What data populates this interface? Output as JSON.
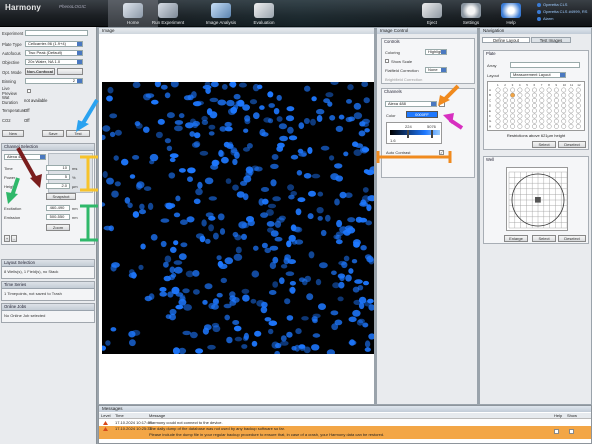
{
  "app": {
    "name": "Harmony",
    "edition": "PhenoLOGIC"
  },
  "nav_tabs": [
    {
      "label": "Home"
    },
    {
      "label": "Run Experiment"
    },
    {
      "label": "Image Analysis"
    },
    {
      "label": "Evaluation"
    },
    {
      "label": "Eject"
    },
    {
      "label": "Settings"
    },
    {
      "label": "Help"
    },
    {
      "label": "Logout"
    }
  ],
  "status": [
    "Operetta CLS",
    "Operetta CLS #4999, RS",
    "Alarm"
  ],
  "setup": {
    "experiment_label": "Experiment",
    "plate_type_label": "Plate Type",
    "plate_type": "Cellcarrier-96 (1.9+4)",
    "autofocus_label": "Autofocus",
    "autofocus": "Two Peak (Default)",
    "objective_label": "Objective",
    "objective": "20x Water, NA 1.0",
    "opt_mode_label": "Opt. Mode",
    "opt_mode": "Non-Confocal",
    "binning_label": "Binning",
    "binning": "2",
    "live_preview_label": "Live Preview",
    "water_dur_label": "Wat Duration",
    "water_dur": "not available",
    "temperature_label": "Temperature",
    "temperature": "Off",
    "co2_label": "CO2",
    "co2": "Off",
    "btn_new": "New",
    "btn_save": "Save",
    "btn_test": "Test"
  },
  "channel": {
    "title": "Channel Selection",
    "name": "Alexa 488",
    "time_label": "Time",
    "time": "10",
    "time_unit": "ms",
    "power_label": "Power",
    "power": "5",
    "power_unit": "%",
    "height_label": "Height",
    "height": "2.0",
    "height_unit": "µm",
    "snapshot": "Snapshot",
    "excitation_label": "Excitation",
    "excitation": "460-490",
    "excitation_unit": "nm",
    "emission_label": "Emission",
    "emission": "500-550",
    "emission_unit": "nm",
    "zoom": "Zoom"
  },
  "layout_selection": {
    "title": "Layout Selection",
    "text": "8 Wells(s), 1 Field(s), no Stack"
  },
  "time_series": {
    "title": "Time Series",
    "text": "1 Timepoints, not saved to Trash"
  },
  "online_jobs": {
    "title": "Online Jobs",
    "text": "No Online Job selected"
  },
  "image": {
    "tab": "Image"
  },
  "image_control": {
    "title": "Image Control",
    "controls_title": "Controls",
    "coloring_label": "Coloring",
    "coloring": "Highlight",
    "show_scale_label": "Show Scale",
    "flatfield_label": "Flatfield Correction",
    "flatfield": "None",
    "brightfield_label": "Brightfield Correction",
    "channels_title": "Channels",
    "channel_name": "Alexa 488",
    "color_label": "Color",
    "color_value": "0000FF",
    "range_lo": "224",
    "range_hi": "5076",
    "range_axis_lo": "1.6",
    "auto_contrast_label": "Auto Contrast"
  },
  "navigation": {
    "title": "Navigation",
    "tab_define": "Define Layout",
    "tab_test": "Test Images",
    "plate_title": "Plate",
    "array_label": "Array",
    "layout_label": "Layout",
    "layout": "Measurement Layout",
    "rows": [
      "A",
      "B",
      "C",
      "D",
      "E",
      "F",
      "G",
      "H"
    ],
    "cols": [
      "1",
      "2",
      "3",
      "4",
      "5",
      "6",
      "7",
      "8",
      "9",
      "10",
      "11",
      "12"
    ],
    "restriction": "Restrictions above 621µm height",
    "btn_select": "Select",
    "btn_deselect": "Deselect",
    "well_title": "Well",
    "btn_enlarge": "Enlarge"
  },
  "messages": {
    "title": "Messages",
    "headers": [
      "Level",
      "Time",
      "Message",
      "Help",
      "Show"
    ],
    "rows": [
      {
        "time": "17.10.2024 10:17:46",
        "text": "Harmony could not connect to the device."
      },
      {
        "time": "17.10.2024 10:25:34",
        "text": "The daily dump of the database was not used by any backup software so far."
      },
      {
        "time": "",
        "text": "Please include the dump file in your regular backup procedure to ensure that, in case of a crash, your Harmony data can be restored."
      }
    ]
  },
  "colors": {
    "accent": "#3a7bd5",
    "warn_row": "#f3a646",
    "nuclei": "#1e78ff"
  }
}
